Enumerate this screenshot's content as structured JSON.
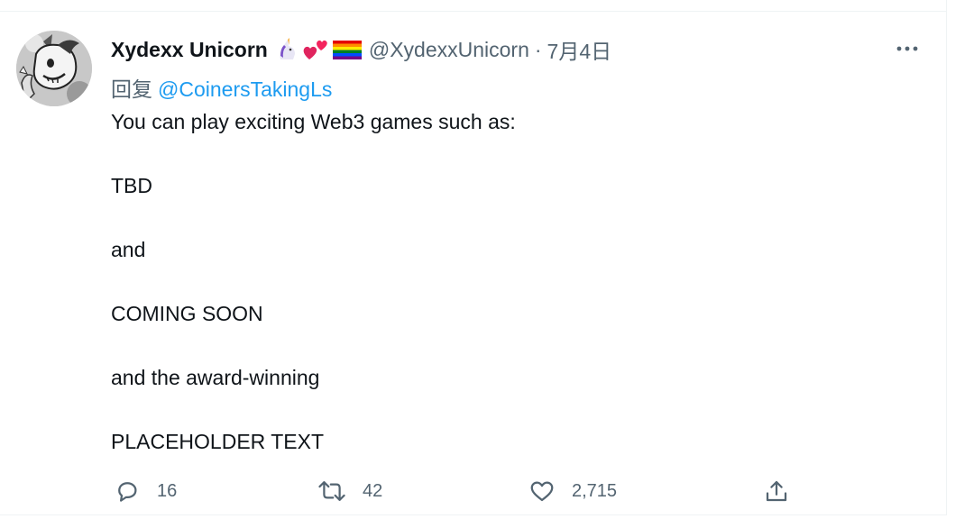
{
  "tweet": {
    "display_name": "Xydexx Unicorn",
    "emojis": [
      "unicorn-emoji",
      "two-hearts-emoji",
      "rainbow-flag-emoji"
    ],
    "handle": "@XydexxUnicorn",
    "separator": "·",
    "date": "7月4日",
    "reply_prefix": "回复",
    "reply_mention": "@CoinersTakingLs",
    "body": {
      "line1": "You can play exciting Web3 games such as:",
      "line2": "TBD",
      "line3": "and",
      "line4": "COMING SOON",
      "line5": "and the award-winning",
      "line6": "PLACEHOLDER TEXT"
    },
    "replies": "16",
    "retweets": "42",
    "likes": "2,715"
  },
  "icons": {
    "more": "more-horizontal-icon",
    "reply": "reply-bubble-icon",
    "retweet": "retweet-icon",
    "like": "heart-icon",
    "share": "share-icon"
  },
  "colors": {
    "text": "#0f1419",
    "secondary": "#536471",
    "link": "#1d9bf0",
    "border": "#eff3f4"
  }
}
